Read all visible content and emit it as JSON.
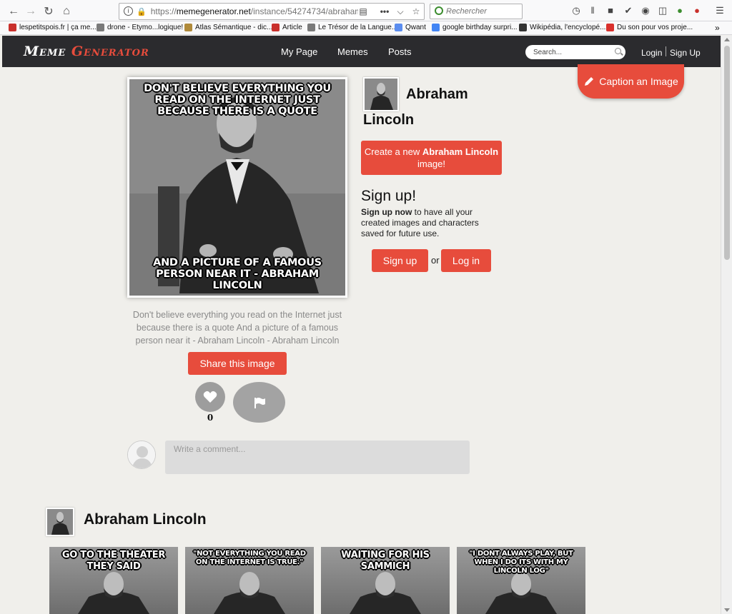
{
  "browser": {
    "url_prefix": "https://",
    "url_host": "memegenerator.net",
    "url_path": "/instance/54274734/abraham",
    "search_placeholder": "Rechercher",
    "bookmarks": [
      {
        "label": "lespetitspois.fr | ça me...",
        "color": "#c9302c"
      },
      {
        "label": "drone - Etymo...logique!",
        "color": "#7a7a7a"
      },
      {
        "label": "Atlas Sémantique - dic...",
        "color": "#b08a3a"
      },
      {
        "label": "Article",
        "color": "#c9302c"
      },
      {
        "label": "Le Trésor de la Langue...",
        "color": "#7a7a7a"
      },
      {
        "label": "Qwant",
        "color": "#5b8def"
      },
      {
        "label": "google birthday surpri...",
        "color": "#4285f4"
      },
      {
        "label": "Wikipédia, l'encyclopé...",
        "color": "#333333"
      },
      {
        "label": "Du son pour vos proje...",
        "color": "#d9302c"
      }
    ]
  },
  "site": {
    "logo_word1": "Meme",
    "logo_word2": "Generator",
    "nav": [
      "My Page",
      "Memes",
      "Posts"
    ],
    "search_placeholder": "Search...",
    "login": "Login",
    "signup": "Sign Up",
    "accent": "#e74c3c"
  },
  "caption_button": "Caption an Image",
  "meme": {
    "top_text": "Don't believe everything you read on the internet just because there is a quote",
    "bottom_text": "And a picture of a famous person near it - Abraham Lincoln",
    "description": "Don't believe everything you read on the Internet just because there is a quote And a picture of a famous person near it - Abraham Lincoln - Abraham Lincoln",
    "share_label": "Share this image",
    "like_count": "0",
    "comment_placeholder": "Write a comment..."
  },
  "generator": {
    "name": "Abraham Lincoln",
    "create_prefix": "Create a new",
    "create_name": "Abraham Lincoln",
    "create_suffix": "image!",
    "signup_title": "Sign up!",
    "signup_bold": "Sign up now",
    "signup_rest": "to have all your created images and characters saved for future use.",
    "signup_button": "Sign up",
    "or_text": "or",
    "login_button": "Log in"
  },
  "gallery": {
    "title": "Abraham Lincoln",
    "items": [
      {
        "text": "Go to the theater they said"
      },
      {
        "text": "\"Not everything you read on the internet is true.\""
      },
      {
        "text": "Waiting for his sammich"
      },
      {
        "text": "\"I dont always play, but when I do its with my Lincoln log\""
      }
    ]
  }
}
